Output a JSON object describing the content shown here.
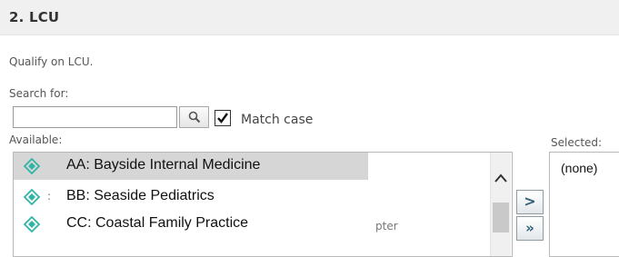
{
  "section": {
    "title": "2. LCU",
    "description": "Qualify on LCU."
  },
  "search": {
    "label": "Search for:",
    "value": "",
    "match_case_label": "Match case",
    "match_case_checked": true
  },
  "available": {
    "label": "Available:",
    "items": [
      {
        "label": "AA:  Bayside Internal Medicine",
        "selected": true
      },
      {
        "label": "BB:  Seaside Pediatrics",
        "selected": false
      },
      {
        "label": "CC: Coastal Family Practice",
        "selected": false
      }
    ],
    "fragments": {
      "row2": ":",
      "row3": "pter"
    }
  },
  "move": {
    "one_label": ">",
    "all_label": "»"
  },
  "selected": {
    "label": "Selected:",
    "empty_text": "(none)"
  },
  "colors": {
    "icon_teal": "#2fb5a5",
    "selection": "#d6d6d6",
    "header_bg": "#f0f0f0"
  },
  "icons": [
    "search-icon",
    "check-icon",
    "diamond-icon",
    "chevron-up-icon"
  ]
}
